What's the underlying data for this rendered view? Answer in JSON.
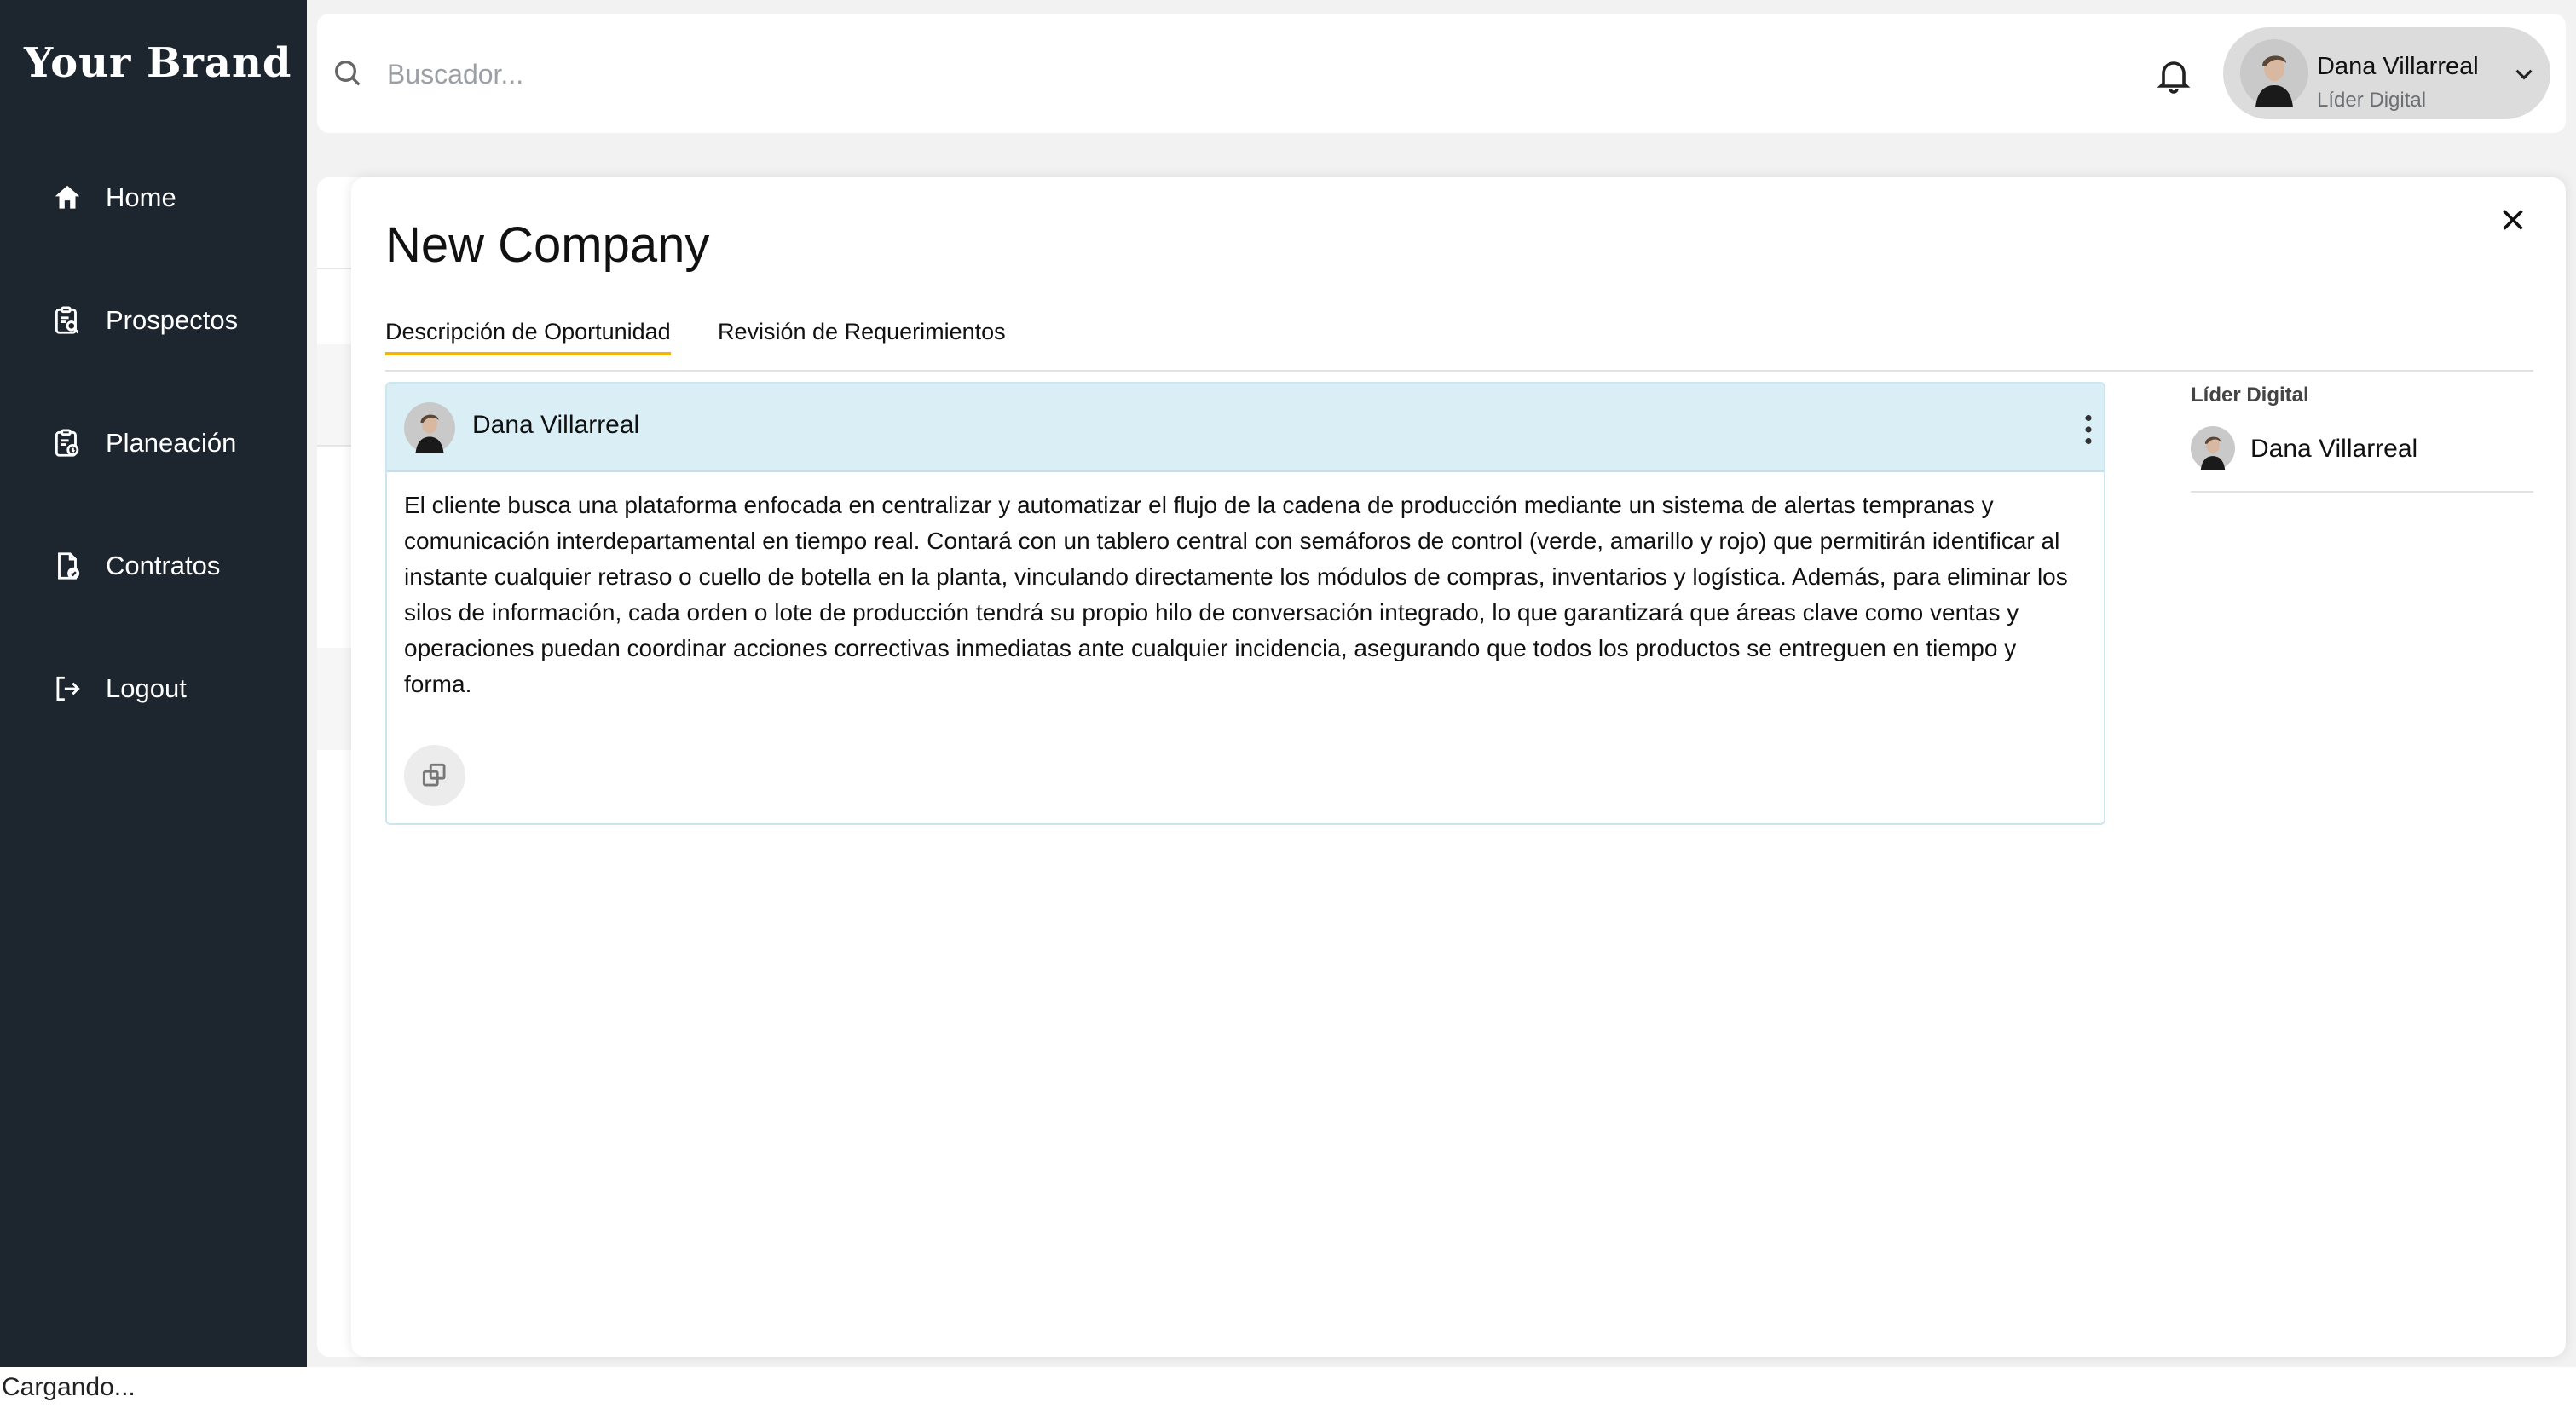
{
  "brand": "Your Brand",
  "sidebar": {
    "items": [
      {
        "label": "Home",
        "icon": "home-icon"
      },
      {
        "label": "Prospectos",
        "icon": "clipboard-search-icon"
      },
      {
        "label": "Planeación",
        "icon": "clipboard-clock-icon"
      },
      {
        "label": "Contratos",
        "icon": "document-check-icon"
      },
      {
        "label": "Logout",
        "icon": "logout-icon"
      }
    ]
  },
  "header": {
    "search_placeholder": "Buscador...",
    "user": {
      "name": "Dana Villarreal",
      "role": "Líder Digital"
    }
  },
  "modal": {
    "title": "New Company",
    "tabs": [
      {
        "label": "Descripción de Oportunidad",
        "active": true
      },
      {
        "label": "Revisión de Requerimientos",
        "active": false
      }
    ],
    "card": {
      "author": "Dana Villarreal",
      "body": "El cliente busca una plataforma enfocada en centralizar y automatizar el flujo de la cadena de producción mediante un sistema de alertas tempranas y comunicación interdepartamental en tiempo real. Contará con un tablero central con semáforos de control (verde, amarillo y rojo) que permitirán identificar al instante cualquier retraso o cuello de botella en la planta, vinculando directamente los módulos de compras, inventarios y logística. Además, para eliminar los silos de información, cada orden o lote de producción tendrá su propio hilo de conversación integrado, lo que garantizará que áreas clave como ventas y operaciones puedan coordinar acciones correctivas inmediatas ante cualquier incidencia, asegurando que todos los productos se entreguen en tiempo y forma."
    },
    "side": {
      "label": "Líder Digital",
      "user": "Dana Villarreal"
    }
  },
  "status_text": "Cargando...",
  "colors": {
    "sidebar_bg": "#1d252e",
    "accent_tab": "#f4b400",
    "card_header_bg": "#d9eef5"
  }
}
